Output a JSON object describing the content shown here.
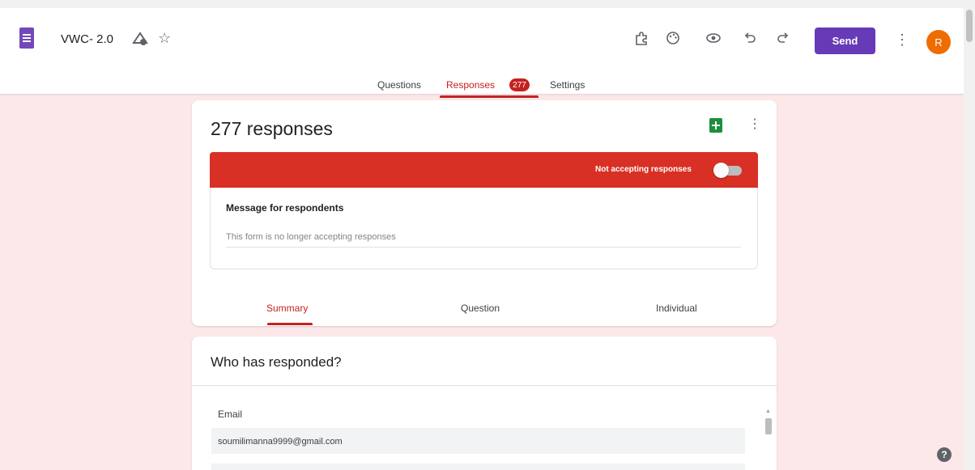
{
  "header": {
    "doc_title": "VWC- 2.0",
    "send_label": "Send",
    "avatar_initial": "R",
    "accent": "#673ab7",
    "icons": [
      "forms-logo-icon",
      "move-to-folder-icon",
      "star-icon",
      "addon-puzzle-icon",
      "palette-icon",
      "preview-eye-icon",
      "undo-icon",
      "redo-icon",
      "more-vert-icon"
    ]
  },
  "tabs": {
    "questions": "Questions",
    "responses": "Responses",
    "responses_badge": "277",
    "settings": "Settings"
  },
  "responses_card": {
    "count_title": "277 responses",
    "accepting_label": "Not accepting responses",
    "accepting_on": false,
    "message_label": "Message for respondents",
    "message_value": "This form is no longer accepting responses",
    "bar_color": "#d93025",
    "subtabs": {
      "summary": "Summary",
      "question": "Question",
      "individual": "Individual"
    }
  },
  "who_card": {
    "title": "Who has responded?",
    "column_header": "Email",
    "emails": [
      "soumilimanna9999@gmail.com"
    ]
  },
  "theme": {
    "background": "#fde8e9",
    "response_red": "#c5221f"
  }
}
